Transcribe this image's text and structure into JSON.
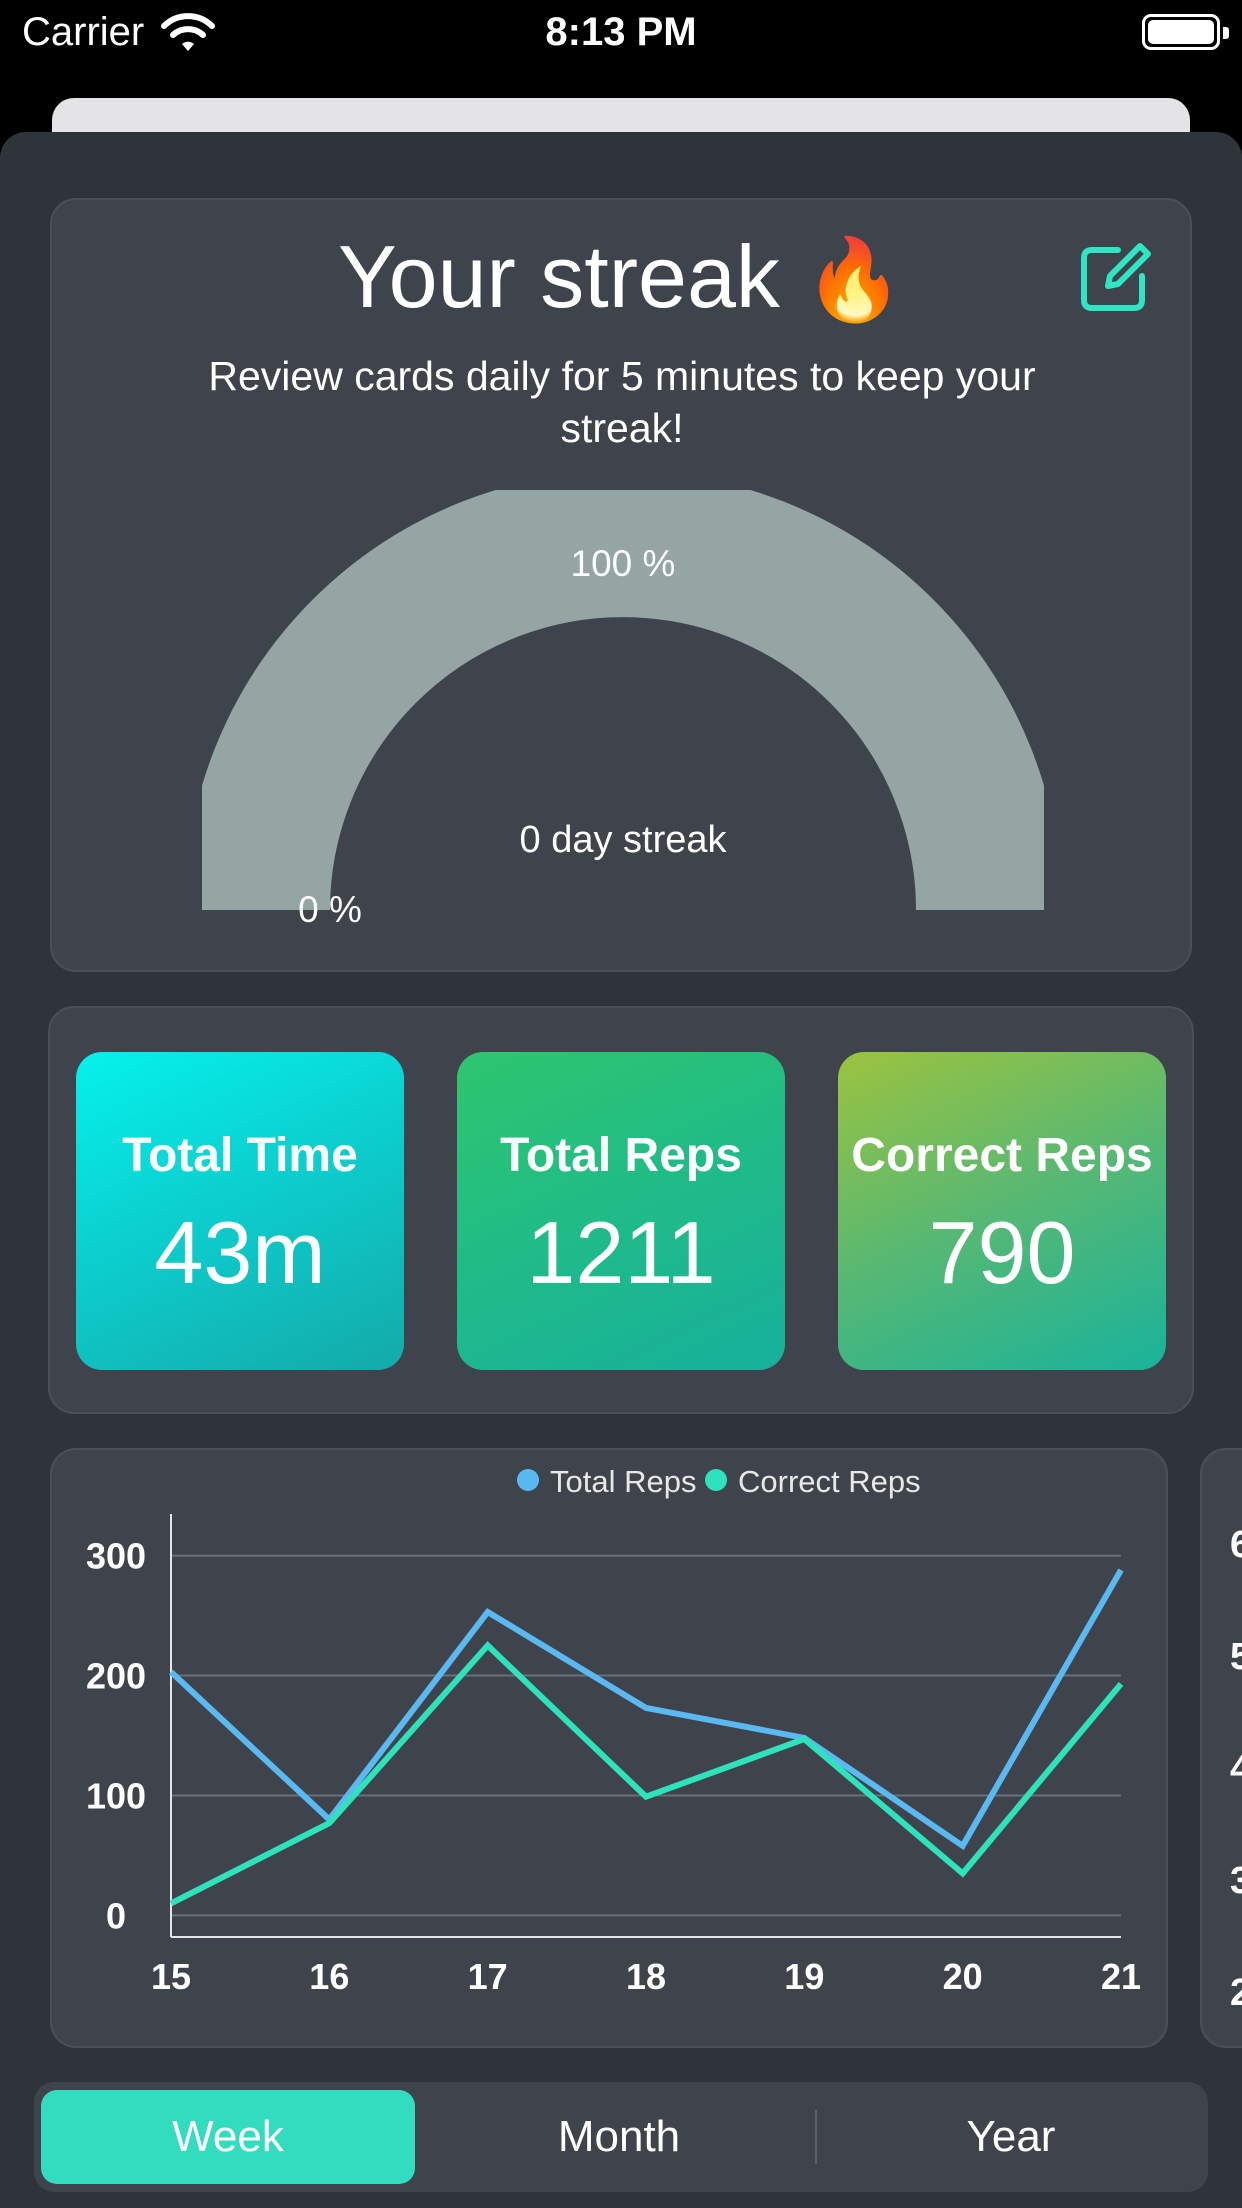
{
  "status_bar": {
    "carrier": "Carrier",
    "time": "8:13 PM"
  },
  "streak": {
    "title": "Your streak",
    "emoji": "🔥",
    "description": "Review cards daily for 5 minutes to keep your streak!",
    "gauge_max_label": "100 %",
    "gauge_min_label": "0 %",
    "center_label": "0 day streak",
    "progress": 0,
    "colors": {
      "track": "#95a5a4",
      "accent": "#2ee6c4"
    }
  },
  "stats": [
    {
      "label": "Total Time",
      "value": "43m"
    },
    {
      "label": "Total Reps",
      "value": "1211"
    },
    {
      "label": "Correct Reps",
      "value": "790"
    }
  ],
  "chart_data": {
    "type": "line",
    "x": [
      "15",
      "16",
      "17",
      "18",
      "19",
      "20",
      "21"
    ],
    "series": [
      {
        "name": "Total Reps",
        "color": "#5bb9f2",
        "values": [
          203,
          80,
          253,
          173,
          148,
          58,
          288
        ]
      },
      {
        "name": "Correct Reps",
        "color": "#2ee2bc",
        "values": [
          10,
          77,
          225,
          99,
          147,
          35,
          193
        ]
      }
    ],
    "yticks": [
      0,
      100,
      200,
      300
    ],
    "ylim": [
      -18,
      318
    ],
    "grid": true,
    "legend_position": "top-center"
  },
  "peek_chart": {
    "tick_labels": [
      "6",
      "5",
      "4",
      "3",
      "2"
    ]
  },
  "period_tabs": [
    {
      "label": "Week",
      "selected": true
    },
    {
      "label": "Month",
      "selected": false
    },
    {
      "label": "Year",
      "selected": false
    }
  ]
}
